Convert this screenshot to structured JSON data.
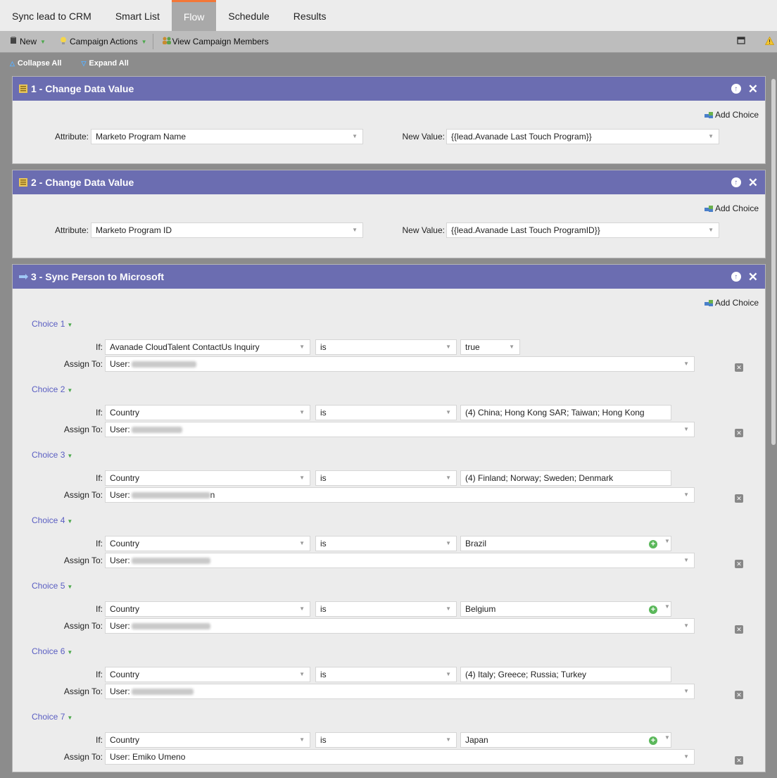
{
  "tabs": [
    {
      "label": "Sync lead to CRM"
    },
    {
      "label": "Smart List"
    },
    {
      "label": "Flow",
      "active": true
    },
    {
      "label": "Schedule"
    },
    {
      "label": "Results"
    }
  ],
  "toolbar": {
    "new_label": "New",
    "campaign_actions_label": "Campaign Actions",
    "view_members_label": "View Campaign Members"
  },
  "subbar": {
    "collapse_label": "Collapse All",
    "expand_label": "Expand All"
  },
  "steps": [
    {
      "title": "1 - Change Data Value",
      "add_choice": "Add Choice",
      "attribute_label": "Attribute:",
      "attribute_value": "Marketo Program Name",
      "new_value_label": "New Value:",
      "new_value": "{{lead.Avanade Last Touch Program}}"
    },
    {
      "title": "2 - Change Data Value",
      "add_choice": "Add Choice",
      "attribute_label": "Attribute:",
      "attribute_value": "Marketo Program ID",
      "new_value_label": "New Value:",
      "new_value": "{{lead.Avanade Last Touch ProgramID}}"
    },
    {
      "title": "3 - Sync Person to Microsoft",
      "add_choice": "Add Choice",
      "if_label": "If:",
      "assign_label": "Assign To:",
      "choices": [
        {
          "label": "Choice 1",
          "field": "Avanade CloudTalent ContactUs Inquiry",
          "op": "is",
          "value": "true",
          "user": "User:"
        },
        {
          "label": "Choice 2",
          "field": "Country",
          "op": "is",
          "value": "(4) China; Hong Kong SAR; Taiwan; Hong Kong",
          "user": "User:"
        },
        {
          "label": "Choice 3",
          "field": "Country",
          "op": "is",
          "value": "(4) Finland; Norway; Sweden; Denmark",
          "user": "User:",
          "user_suffix": "n"
        },
        {
          "label": "Choice 4",
          "field": "Country",
          "op": "is",
          "value": "Brazil",
          "user": "User:"
        },
        {
          "label": "Choice 5",
          "field": "Country",
          "op": "is",
          "value": "Belgium",
          "user": "User:"
        },
        {
          "label": "Choice 6",
          "field": "Country",
          "op": "is",
          "value": "(4) Italy; Greece; Russia; Turkey",
          "user": "User:"
        },
        {
          "label": "Choice 7",
          "field": "Country",
          "op": "is",
          "value": "Japan",
          "user": "User: Emiko Umeno"
        }
      ]
    }
  ],
  "colors": {
    "header_purple": "#6b6db1",
    "tab_accent": "#f37737",
    "choice_link": "#5a5ec2",
    "add_green": "#5bb85b"
  }
}
